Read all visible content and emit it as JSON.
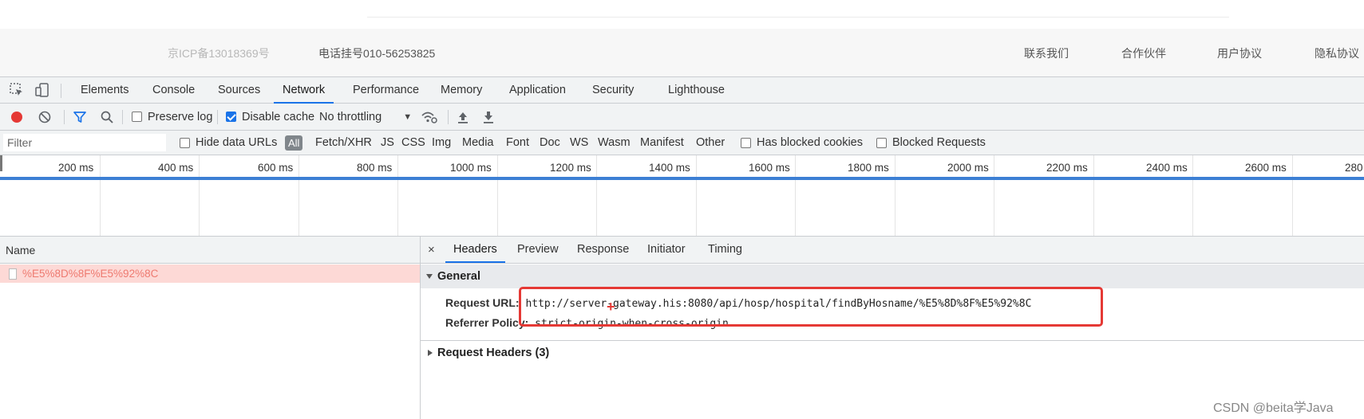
{
  "footer": {
    "icp": "京ICP备13018369号",
    "phone": "电话挂号010-56253825",
    "links": [
      "联系我们",
      "合作伙伴",
      "用户协议",
      "隐私协议"
    ]
  },
  "devtools": {
    "tabs": [
      "Elements",
      "Console",
      "Sources",
      "Network",
      "Performance",
      "Memory",
      "Application",
      "Security",
      "Lighthouse"
    ],
    "active_tab": "Network",
    "icons": [
      "inspect-element-icon",
      "device-toolbar-icon"
    ]
  },
  "toolbar": {
    "preserve_log": "Preserve log",
    "preserve_log_checked": false,
    "disable_cache": "Disable cache",
    "disable_cache_checked": true,
    "throttling": "No throttling",
    "icons": [
      "record-icon",
      "clear-icon",
      "filter-icon",
      "search-icon",
      "network-conditions-icon",
      "import-har-icon",
      "export-har-icon"
    ]
  },
  "filterbar": {
    "placeholder": "Filter",
    "hide_data_urls": "Hide data URLs",
    "all": "All",
    "types": [
      "Fetch/XHR",
      "JS",
      "CSS",
      "Img",
      "Media",
      "Font",
      "Doc",
      "WS",
      "Wasm",
      "Manifest",
      "Other"
    ],
    "blocked_cookies": "Has blocked cookies",
    "blocked_requests": "Blocked Requests"
  },
  "timeline": {
    "ticks": [
      "200 ms",
      "400 ms",
      "600 ms",
      "800 ms",
      "1000 ms",
      "1200 ms",
      "1400 ms",
      "1600 ms",
      "1800 ms",
      "2000 ms",
      "2200 ms",
      "2400 ms",
      "2600 ms",
      "280"
    ]
  },
  "requests": {
    "column_name": "Name",
    "rows": [
      {
        "name": "%E5%8D%8F%E5%92%8C",
        "status": "failed"
      }
    ]
  },
  "detail": {
    "close": "×",
    "tabs": [
      "Headers",
      "Preview",
      "Response",
      "Initiator",
      "Timing"
    ],
    "active_tab": "Headers",
    "general": {
      "title": "General",
      "request_url_label": "Request URL:",
      "request_url": "http://server-gateway.his:8080/api/hosp/hospital/findByHosname/%E5%8D%8F%E5%92%8C",
      "referrer_label": "Referrer Policy:",
      "referrer_value": "strict-origin-when-cross-origin"
    },
    "request_headers": "Request Headers (3)"
  },
  "watermark": "CSDN @beita学Java",
  "colors": {
    "accent": "#1a73e8",
    "failed_row": "#fdd9d6",
    "annotation": "#e53935",
    "record": "#e53935"
  }
}
